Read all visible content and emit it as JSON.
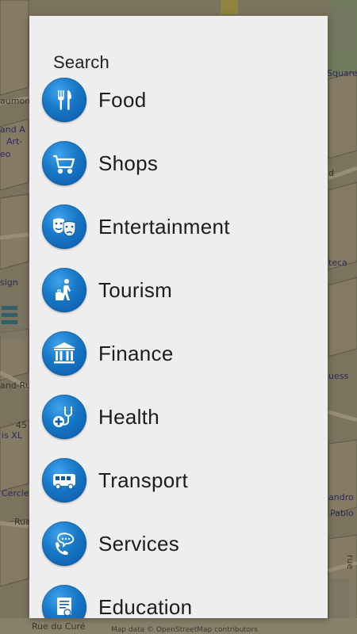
{
  "dialog": {
    "title": "Search",
    "items": [
      {
        "label": "Food",
        "icon": "fork-knife-icon"
      },
      {
        "label": "Shops",
        "icon": "shopping-cart-icon"
      },
      {
        "label": "Entertainment",
        "icon": "theater-masks-icon"
      },
      {
        "label": "Tourism",
        "icon": "traveler-luggage-icon"
      },
      {
        "label": "Finance",
        "icon": "bank-building-icon"
      },
      {
        "label": "Health",
        "icon": "stethoscope-icon"
      },
      {
        "label": "Transport",
        "icon": "bus-icon"
      },
      {
        "label": "Services",
        "icon": "phone-service-icon"
      },
      {
        "label": "Education",
        "icon": "diploma-icon"
      }
    ]
  },
  "map": {
    "labels": {
      "l1": "aumon",
      "l2": "and A",
      "l3": "Art-",
      "l4": "eo",
      "l5": "sign",
      "l6": "and-Rue",
      "l7": "45",
      "l8": "is XL",
      "l9": "Cercle",
      "l10": "Rue",
      "l11": "Rue du Curé",
      "l12": "Square",
      "l13": "d",
      "l14": "teca",
      "l15": "uess",
      "l16": "andro",
      "l17": "Pablo",
      "l18": "rue"
    },
    "attribution": "Map data © OpenStreetMap contributors"
  },
  "colors": {
    "accent": "#1676c6",
    "dialog_bg": "#eeeeee",
    "map_dim": "#7a705a"
  }
}
